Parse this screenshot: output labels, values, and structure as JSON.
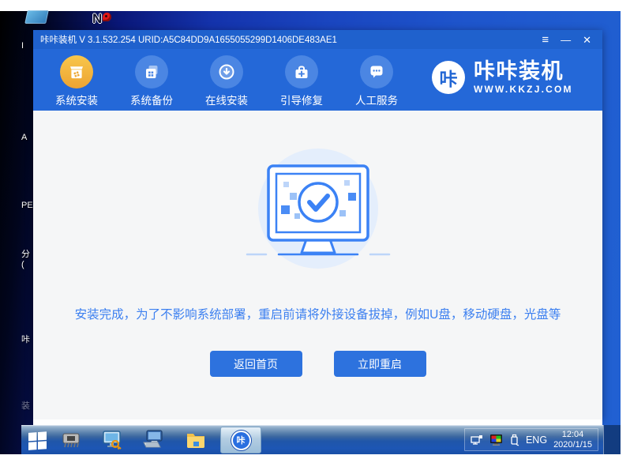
{
  "desktop": {
    "top_icons": [
      {
        "name": "folder"
      },
      {
        "name": "network-key",
        "glyph": "N"
      }
    ],
    "partial_labels": [
      {
        "text": "I"
      },
      {
        "text": "A"
      },
      {
        "text": "PE"
      },
      {
        "text": "分"
      },
      {
        "text": "("
      },
      {
        "text": "咔"
      },
      {
        "text": "装"
      }
    ]
  },
  "window": {
    "title": "咔咔装机 V 3.1.532.254 URID:A5C84DD9A1655055299D1406DE483AE1",
    "controls": {
      "menu": "≡",
      "minimize": "—",
      "close": "✕"
    },
    "nav": {
      "items": [
        {
          "label": "系统安装",
          "active": true
        },
        {
          "label": "系统备份",
          "active": false
        },
        {
          "label": "在线安装",
          "active": false
        },
        {
          "label": "引导修复",
          "active": false
        },
        {
          "label": "人工服务",
          "active": false
        }
      ]
    },
    "logo": {
      "badge": "咔",
      "name": "咔咔装机",
      "site": "WWW.KKZJ.COM"
    },
    "main": {
      "message": "安装完成，为了不影响系统部署，重启前请将外接设备拔掉，例如U盘，移动硬盘，光盘等",
      "buttons": [
        {
          "label": "返回首页"
        },
        {
          "label": "立即重启"
        }
      ]
    }
  },
  "taskbar": {
    "kaka_glyph": "咔",
    "tray": {
      "language": "ENG",
      "time": "12:04",
      "date": "2020/1/15"
    }
  },
  "colors": {
    "accent": "#2d72de",
    "titlebar": "#1f61cd",
    "navbar": "#2468d8",
    "active_nav": "#f2b43f",
    "message_text": "#3d80f0",
    "desktop_blue": "#1e55cc"
  }
}
